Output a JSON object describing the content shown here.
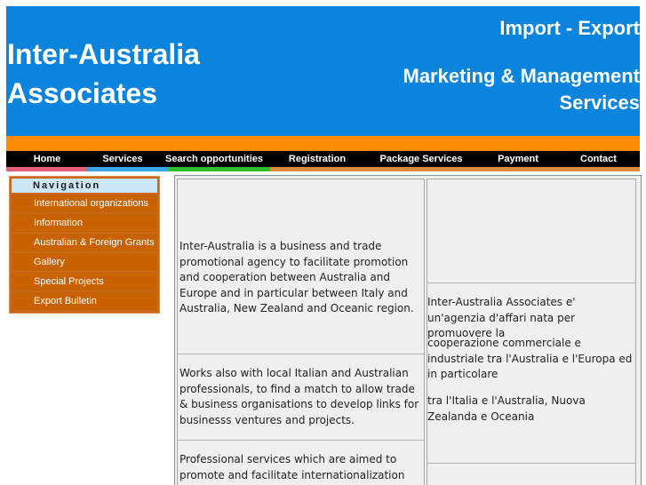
{
  "header": {
    "title_line1": "Inter-Australia",
    "title_line2": "Associates",
    "tagline1": "Import - Export",
    "tagline2_line1": "Marketing & Management",
    "tagline2_line2": "Services",
    "bg_color": "#0a84dc",
    "strip_color": "#ff8c00"
  },
  "topnav": {
    "items": [
      "Home",
      "Services",
      "Search opportunities",
      "Registration",
      "Package Services",
      "Payment",
      "Contact"
    ]
  },
  "accent_colors": [
    "#e2607a",
    "#3aa4e8",
    "#2fbf2f",
    "#d98c3c"
  ],
  "sidebar": {
    "heading": "Navigation",
    "items": [
      "International organizations",
      "Information",
      "Australian & Foreign Grants",
      "Gallery",
      "Special Projects",
      "Export Bulletin"
    ]
  },
  "content": {
    "english": [
      "Inter-Australia is a business and trade promotional agency to facilitate promotion and cooperation between Australia and Europe and in particular between Italy and Australia, New Zealand and Oceanic region.",
      "Works also with local Italian and Australian professionals, to find a match to allow trade & business organisations to develop links for businesss ventures and projects.",
      "Professional services which are aimed to promote and facilitate internationalization"
    ],
    "italian": [
      "Inter-Australia Associates e' un'agenzia d'affari nata per promuovere la",
      "cooperazione commerciale e industriale tra l'Australia e l'Europa ed in particolare",
      "tra l'Italia e l'Australia, Nuova Zealanda e Oceania"
    ]
  }
}
